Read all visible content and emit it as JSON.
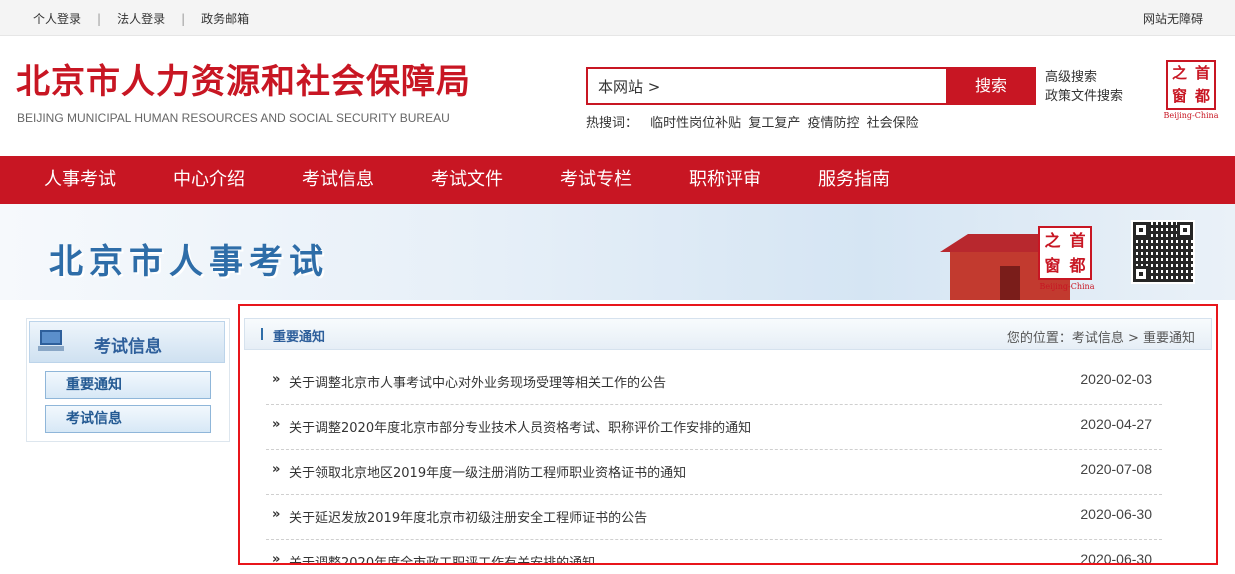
{
  "topbar": {
    "links": [
      "个人登录",
      "法人登录",
      "政务邮箱"
    ],
    "separator": "|",
    "accessibility": "网站无障碍"
  },
  "header": {
    "logo_cn": "北京市人力资源和社会保障局",
    "logo_en": "BEIJING MUNICIPAL HUMAN RESOURCES AND SOCIAL SECURITY BUREAU",
    "search_value": "本网站 >",
    "search_button": "搜索",
    "advanced_search": "高级搜索",
    "policy_search": "政策文件搜索",
    "hot_label": "热搜词：",
    "hot_words": [
      "临时性岗位补贴",
      "复工复产",
      "疫情防控",
      "社会保险"
    ],
    "seal_chars": [
      "之",
      "首",
      "窗",
      "都"
    ],
    "seal_sub": "Beijing-China"
  },
  "nav": [
    "人事考试",
    "中心介绍",
    "考试信息",
    "考试文件",
    "考试专栏",
    "职称评审",
    "服务指南"
  ],
  "banner": {
    "title": "北京市人事考试",
    "seal_chars": [
      "之",
      "首",
      "窗",
      "都"
    ],
    "seal_sub": "Beijing-China"
  },
  "sidebar": {
    "title": "考试信息",
    "items": [
      "重要通知",
      "考试信息"
    ]
  },
  "main": {
    "title": "重要通知",
    "breadcrumb": "您的位置：考试信息 > 重要通知",
    "arrow": "»",
    "items": [
      {
        "title": "关于调整北京市人事考试中心对外业务现场受理等相关工作的公告",
        "date": "2020-02-03"
      },
      {
        "title": "关于调整2020年度北京市部分专业技术人员资格考试、职称评价工作安排的通知",
        "date": "2020-04-27"
      },
      {
        "title": "关于领取北京地区2019年度一级注册消防工程师职业资格证书的通知",
        "date": "2020-07-08"
      },
      {
        "title": "关于延迟发放2019年度北京市初级注册安全工程师证书的公告",
        "date": "2020-06-30"
      },
      {
        "title": "关于调整2020年度全市政工职评工作有关安排的通知",
        "date": "2020-06-30"
      }
    ]
  },
  "colors": {
    "brand_red": "#c81623",
    "highlight_border": "#e8151b",
    "link_blue": "#2e5f9b"
  }
}
